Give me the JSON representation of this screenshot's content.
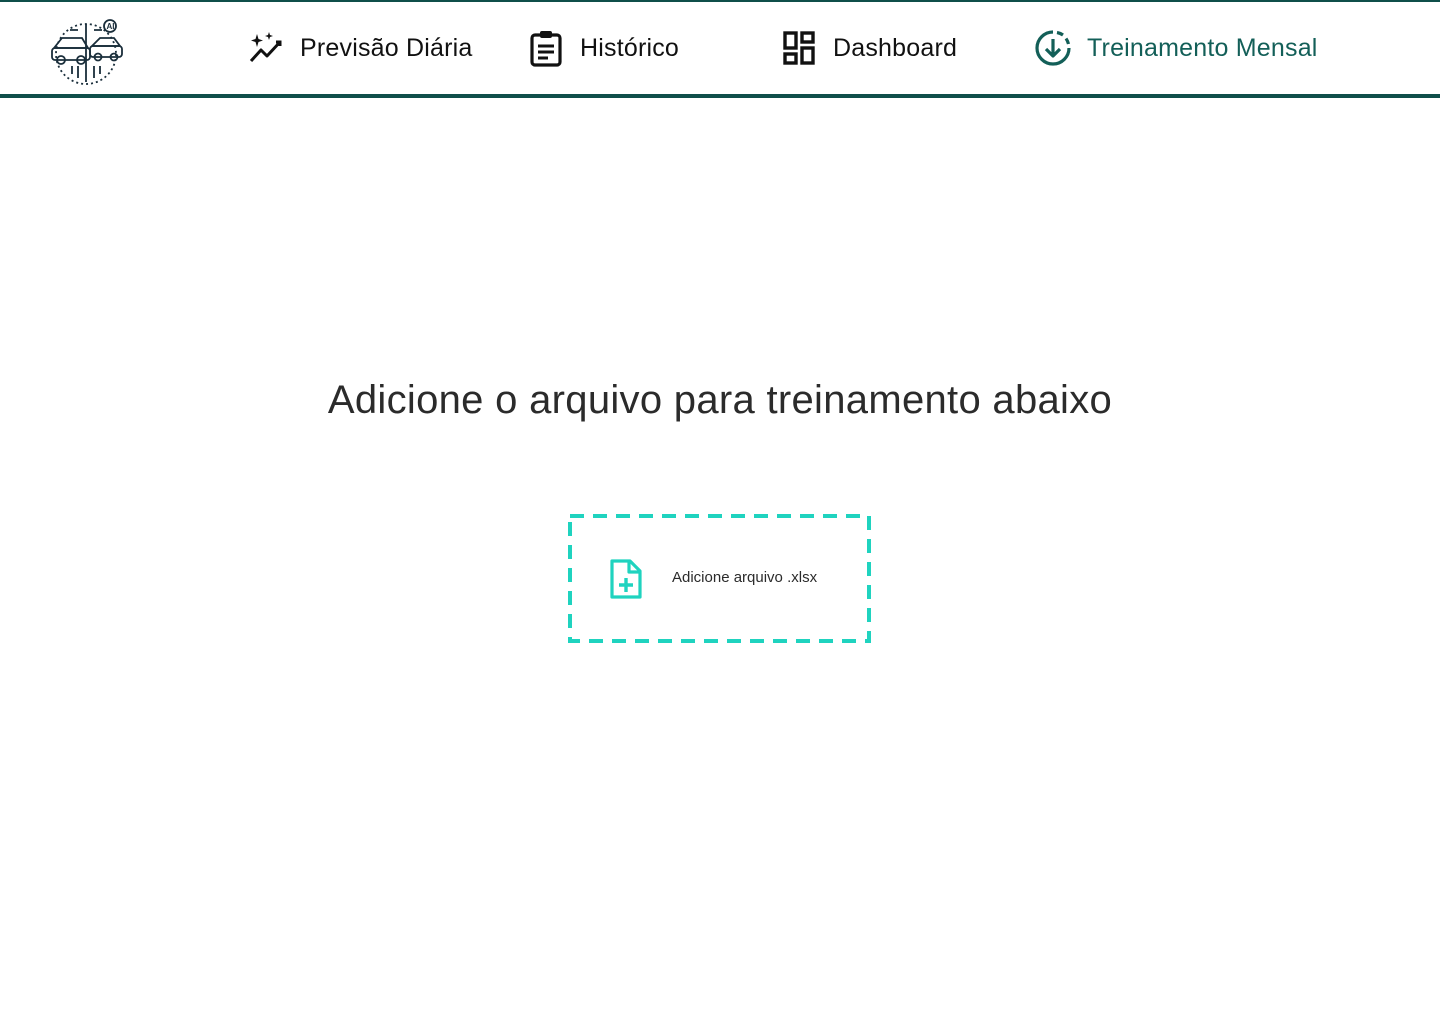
{
  "header": {
    "logo_icon": "car-circuit-ai-logo",
    "nav": [
      {
        "label": "Previsão Diária",
        "icon": "sparkle-chart-icon",
        "active": false
      },
      {
        "label": "Histórico",
        "icon": "clipboard-icon",
        "active": false
      },
      {
        "label": "Dashboard",
        "icon": "dashboard-grid-icon",
        "active": false
      },
      {
        "label": "Treinamento Mensal",
        "icon": "download-circle-icon",
        "active": true
      }
    ]
  },
  "main": {
    "title": "Adicione o arquivo para treinamento abaixo",
    "dropzone": {
      "label": "Adicione arquivo .xlsx",
      "icon": "file-add-icon"
    }
  },
  "colors": {
    "accent_dark": "#0f4f4a",
    "active_text": "#135f58",
    "dropzone_border": "#1fd3bf",
    "text": "#2b2b2b"
  }
}
